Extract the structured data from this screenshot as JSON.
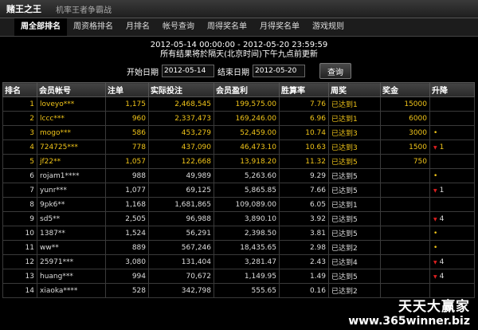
{
  "header": {
    "title": "赌王之王",
    "subtitle": "机率王者争霸战"
  },
  "tabs": [
    "周全部排名",
    "周资格排名",
    "月排名",
    "帐号查询",
    "周得奖名单",
    "月得奖名单",
    "游戏规则"
  ],
  "range": {
    "period": "2012-05-14 00:00:00 - 2012-05-20 23:59:59",
    "note": "所有结果将於隔天(北京时间)下午九点前更新"
  },
  "filters": {
    "start_label": "开始日期",
    "start_value": "2012-05-14",
    "end_label": "结束日期",
    "end_value": "2012-05-20",
    "query_label": "查询"
  },
  "table": {
    "headers": [
      "排名",
      "会员帐号",
      "注单",
      "实际投注",
      "会员盈利",
      "胜算率",
      "周奖",
      "奖金",
      "升降"
    ],
    "rows": [
      {
        "rank": "1",
        "account": "loveyo***",
        "bets": "1,175",
        "wager": "2,468,545",
        "profit": "199,575.00",
        "rate": "7.76",
        "prize": "已达到1",
        "bonus": "15000",
        "trend": "",
        "trend_type": "none",
        "top": true
      },
      {
        "rank": "2",
        "account": "lccc***",
        "bets": "960",
        "wager": "2,337,473",
        "profit": "169,246.00",
        "rate": "6.96",
        "prize": "已达到1",
        "bonus": "6000",
        "trend": "",
        "trend_type": "none",
        "top": true
      },
      {
        "rank": "3",
        "account": "mogo***",
        "bets": "586",
        "wager": "453,279",
        "profit": "52,459.00",
        "rate": "10.74",
        "prize": "已达到3",
        "bonus": "3000",
        "trend": "•",
        "trend_type": "same",
        "top": true
      },
      {
        "rank": "4",
        "account": "724725***",
        "bets": "778",
        "wager": "437,090",
        "profit": "46,473.10",
        "rate": "10.63",
        "prize": "已达到3",
        "bonus": "1500",
        "trend": "1",
        "trend_type": "down",
        "top": true
      },
      {
        "rank": "5",
        "account": "jf22**",
        "bets": "1,057",
        "wager": "122,668",
        "profit": "13,918.20",
        "rate": "11.32",
        "prize": "已达到5",
        "bonus": "750",
        "trend": "",
        "trend_type": "none",
        "top": true
      },
      {
        "rank": "6",
        "account": "rojam1****",
        "bets": "988",
        "wager": "49,989",
        "profit": "5,263.60",
        "rate": "9.29",
        "prize": "已达到5",
        "bonus": "",
        "trend": "•",
        "trend_type": "same",
        "top": false
      },
      {
        "rank": "7",
        "account": "yunr***",
        "bets": "1,077",
        "wager": "69,125",
        "profit": "5,865.85",
        "rate": "7.66",
        "prize": "已达到5",
        "bonus": "",
        "trend": "1",
        "trend_type": "down",
        "top": false
      },
      {
        "rank": "8",
        "account": "9pk6**",
        "bets": "1,168",
        "wager": "1,681,865",
        "profit": "109,089.00",
        "rate": "6.05",
        "prize": "已达到1",
        "bonus": "",
        "trend": "",
        "trend_type": "none",
        "top": false
      },
      {
        "rank": "9",
        "account": "sd5**",
        "bets": "2,505",
        "wager": "96,988",
        "profit": "3,890.10",
        "rate": "3.92",
        "prize": "已达到5",
        "bonus": "",
        "trend": "4",
        "trend_type": "down",
        "top": false
      },
      {
        "rank": "10",
        "account": "1387**",
        "bets": "1,524",
        "wager": "56,291",
        "profit": "2,398.50",
        "rate": "3.81",
        "prize": "已达到5",
        "bonus": "",
        "trend": "•",
        "trend_type": "same",
        "top": false
      },
      {
        "rank": "11",
        "account": "ww**",
        "bets": "889",
        "wager": "567,246",
        "profit": "18,435.65",
        "rate": "2.98",
        "prize": "已达到2",
        "bonus": "",
        "trend": "•",
        "trend_type": "same",
        "top": false
      },
      {
        "rank": "12",
        "account": "25971***",
        "bets": "3,080",
        "wager": "131,404",
        "profit": "3,281.47",
        "rate": "2.43",
        "prize": "已达到4",
        "bonus": "",
        "trend": "4",
        "trend_type": "down",
        "top": false
      },
      {
        "rank": "13",
        "account": "huang***",
        "bets": "994",
        "wager": "70,672",
        "profit": "1,149.95",
        "rate": "1.49",
        "prize": "已达到5",
        "bonus": "",
        "trend": "4",
        "trend_type": "down",
        "top": false
      },
      {
        "rank": "14",
        "account": "xiaoka****",
        "bets": "528",
        "wager": "342,798",
        "profit": "555.65",
        "rate": "0.16",
        "prize": "已达到2",
        "bonus": "",
        "trend": "",
        "trend_type": "none",
        "top": false
      }
    ]
  },
  "watermark": {
    "line1": "天天大赢家",
    "line2": "www.365winner.biz"
  }
}
